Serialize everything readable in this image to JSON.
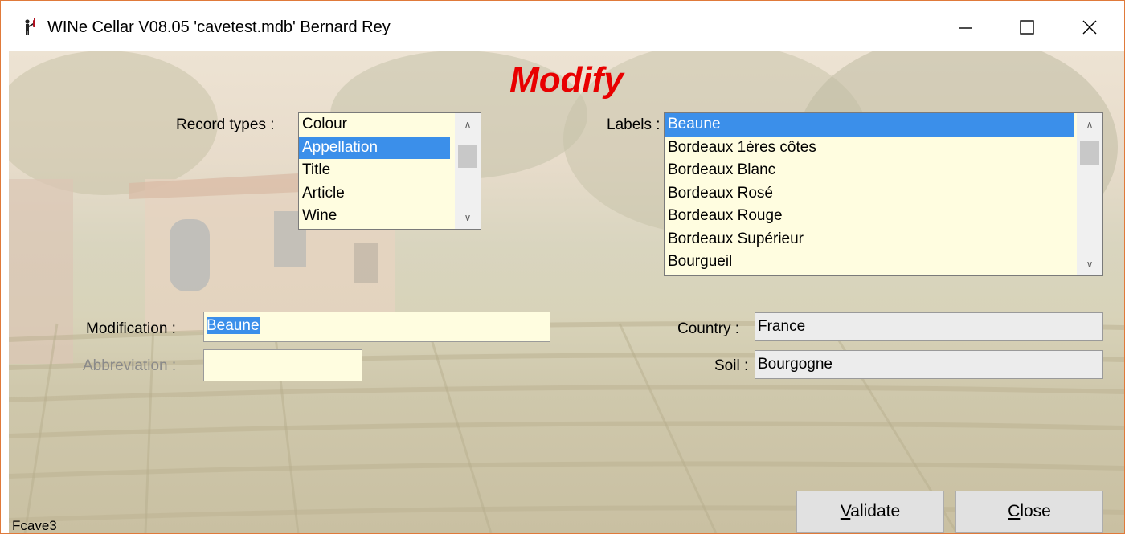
{
  "window": {
    "title": "WINe Cellar V08.05  'cavetest.mdb'  Bernard Rey",
    "icon": "wine-waiter-icon",
    "controls": [
      "minimize-icon",
      "maximize-icon",
      "close-icon"
    ]
  },
  "form": {
    "heading": "Modify",
    "record_types_label": "Record types :",
    "record_types": [
      "Colour",
      "Appellation",
      "Title",
      "Article",
      "Wine"
    ],
    "record_types_selected": "Appellation",
    "labels_label": "Labels :",
    "labels": [
      "Beaune",
      "Bordeaux 1ères côtes",
      "Bordeaux Blanc",
      "Bordeaux Rosé",
      "Bordeaux Rouge",
      "Bordeaux Supérieur",
      "Bourgueil"
    ],
    "labels_selected": "Beaune",
    "modification_label": "Modification :",
    "modification_value": "Beaune",
    "abbreviation_label": "Abbreviation :",
    "abbreviation_value": "",
    "country_label": "Country :",
    "country_value": "France",
    "soil_label": "Soil :",
    "soil_value": "Bourgogne",
    "validate_prefix": "V",
    "validate_rest": "alidate",
    "close_prefix": "C",
    "close_rest": "lose",
    "footer_code": "Fcave3"
  },
  "colors": {
    "heading": "#e80000",
    "selection": "#3b8fea",
    "list_background": "#fffde0",
    "window_border": "#e07a3a"
  }
}
